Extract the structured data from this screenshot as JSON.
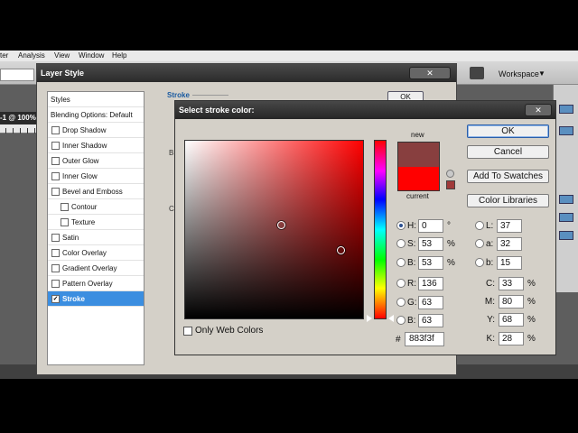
{
  "menubar": {
    "items": [
      "ter",
      "Analysis",
      "View",
      "Window",
      "Help"
    ]
  },
  "workspace": {
    "label": "Workspace",
    "caret": "▼"
  },
  "document": {
    "tab": "-1 @ 100%"
  },
  "layer_style": {
    "title": "Layer Style",
    "styles": [
      {
        "label": "Styles",
        "checkbox": false,
        "checked": false,
        "indent": false,
        "selected": false
      },
      {
        "label": "Blending Options: Default",
        "checkbox": false,
        "checked": false,
        "indent": false,
        "selected": false
      },
      {
        "label": "Drop Shadow",
        "checkbox": true,
        "checked": false,
        "indent": false,
        "selected": false
      },
      {
        "label": "Inner Shadow",
        "checkbox": true,
        "checked": false,
        "indent": false,
        "selected": false
      },
      {
        "label": "Outer Glow",
        "checkbox": true,
        "checked": false,
        "indent": false,
        "selected": false
      },
      {
        "label": "Inner Glow",
        "checkbox": true,
        "checked": false,
        "indent": false,
        "selected": false
      },
      {
        "label": "Bevel and Emboss",
        "checkbox": true,
        "checked": false,
        "indent": false,
        "selected": false
      },
      {
        "label": "Contour",
        "checkbox": true,
        "checked": false,
        "indent": true,
        "selected": false
      },
      {
        "label": "Texture",
        "checkbox": true,
        "checked": false,
        "indent": true,
        "selected": false
      },
      {
        "label": "Satin",
        "checkbox": true,
        "checked": false,
        "indent": false,
        "selected": false
      },
      {
        "label": "Color Overlay",
        "checkbox": true,
        "checked": false,
        "indent": false,
        "selected": false
      },
      {
        "label": "Gradient Overlay",
        "checkbox": true,
        "checked": false,
        "indent": false,
        "selected": false
      },
      {
        "label": "Pattern Overlay",
        "checkbox": true,
        "checked": false,
        "indent": false,
        "selected": false
      },
      {
        "label": "Stroke",
        "checkbox": true,
        "checked": true,
        "indent": false,
        "selected": true
      }
    ],
    "section_title": "Stroke",
    "ok_label": "OK",
    "fragments": {
      "b": "B",
      "c": "C"
    }
  },
  "picker": {
    "title": "Select stroke color:",
    "new_label": "new",
    "current_label": "current",
    "new_color": "#883f3f",
    "current_color": "#ff0000",
    "gamut_color": "#a03a3a",
    "buttons": {
      "ok": "OK",
      "cancel": "Cancel",
      "add_swatches": "Add To Swatches",
      "libraries": "Color Libraries"
    },
    "web_colors_label": "Only Web Colors",
    "hsb": [
      {
        "label": "H:",
        "value": "0",
        "unit": "°",
        "selected": true
      },
      {
        "label": "S:",
        "value": "53",
        "unit": "%",
        "selected": false
      },
      {
        "label": "B:",
        "value": "53",
        "unit": "%",
        "selected": false
      }
    ],
    "rgb": [
      {
        "label": "R:",
        "value": "136",
        "selected": false
      },
      {
        "label": "G:",
        "value": "63",
        "selected": false
      },
      {
        "label": "B:",
        "value": "63",
        "selected": false
      }
    ],
    "lab": [
      {
        "label": "L:",
        "value": "37"
      },
      {
        "label": "a:",
        "value": "32"
      },
      {
        "label": "b:",
        "value": "15"
      }
    ],
    "cmyk": [
      {
        "label": "C:",
        "value": "33",
        "unit": "%"
      },
      {
        "label": "M:",
        "value": "80",
        "unit": "%"
      },
      {
        "label": "Y:",
        "value": "68",
        "unit": "%"
      },
      {
        "label": "K:",
        "value": "28",
        "unit": "%"
      }
    ],
    "hex_label": "#",
    "hex_value": "883f3f",
    "hue_color": "#ff0000"
  }
}
